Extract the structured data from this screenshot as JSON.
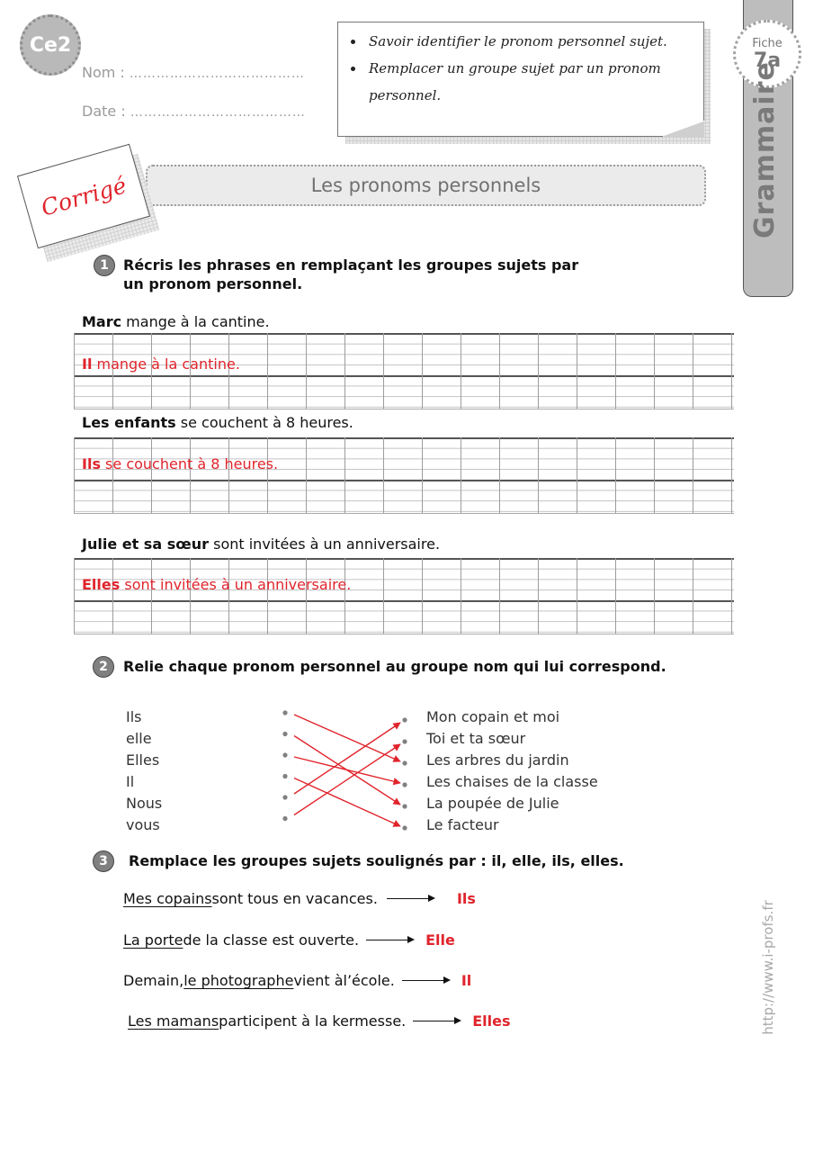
{
  "header": {
    "level": "Ce2",
    "name_label": "Nom :",
    "date_label": "Date :",
    "dots": "…………………………………",
    "objectives": [
      "Savoir identifier le pronom personnel sujet.",
      "Remplacer un groupe sujet par un pronom personnel."
    ]
  },
  "side_tab": {
    "fiche_label": "Fiche",
    "fiche_number": "7a",
    "subject": "Grammaire",
    "url": "http://www.i-profs.fr"
  },
  "corrige_label": "Corrigé",
  "title": "Les pronoms personnels",
  "exercise1": {
    "number": "1",
    "instruction": "Récris les phrases en remplaçant les groupes sujets par un pronom personnel.",
    "items": [
      {
        "subject": "Marc",
        "rest": " mange à la cantine.",
        "answer_pronoun": "Il",
        "answer_rest": " mange à la cantine."
      },
      {
        "subject": "Les enfants",
        "rest": " se couchent à 8 heures.",
        "answer_pronoun": "Ils",
        "answer_rest": " se couchent à 8 heures."
      },
      {
        "subject": "Julie et sa sœur",
        "rest": " sont invitées à un anniversaire.",
        "answer_pronoun": "Elles",
        "answer_rest": " sont invitées à un anniversaire."
      }
    ]
  },
  "exercise2": {
    "number": "2",
    "instruction": "Relie chaque pronom personnel au groupe nom qui lui correspond.",
    "pronouns": [
      "Ils",
      "elle",
      "Elles",
      "Il",
      "Nous",
      "vous"
    ],
    "groups": [
      "Mon copain et moi",
      "Toi et ta sœur",
      "Les arbres du jardin",
      "Les chaises de la classe",
      "La poupée de Julie",
      "Le facteur"
    ],
    "links": [
      {
        "from": "Ils",
        "to": "Les arbres du jardin"
      },
      {
        "from": "elle",
        "to": "La poupée de Julie"
      },
      {
        "from": "Elles",
        "to": "Les chaises de la classe"
      },
      {
        "from": "Il",
        "to": "Le facteur"
      },
      {
        "from": "Nous",
        "to": "Mon copain et moi"
      },
      {
        "from": "vous",
        "to": "Toi et ta sœur"
      }
    ],
    "link_color": "#e0242c"
  },
  "exercise3": {
    "number": "3",
    "instruction": "Remplace les groupes sujets soulignés par : il, elle, ils, elles.",
    "items": [
      {
        "before": "",
        "underlined": "Mes copains",
        "after": " sont tous en vacances.",
        "answer": "Ils"
      },
      {
        "before": "",
        "underlined": "La porte",
        "after": " de la classe est ouverte.",
        "answer": "Elle"
      },
      {
        "before": "Demain, ",
        "underlined": "le photographe",
        "after": " vient àl’école.",
        "answer": "Il"
      },
      {
        "before": "",
        "underlined": "Les mamans",
        "after": " participent à la kermesse.",
        "answer": "Elles"
      }
    ]
  }
}
